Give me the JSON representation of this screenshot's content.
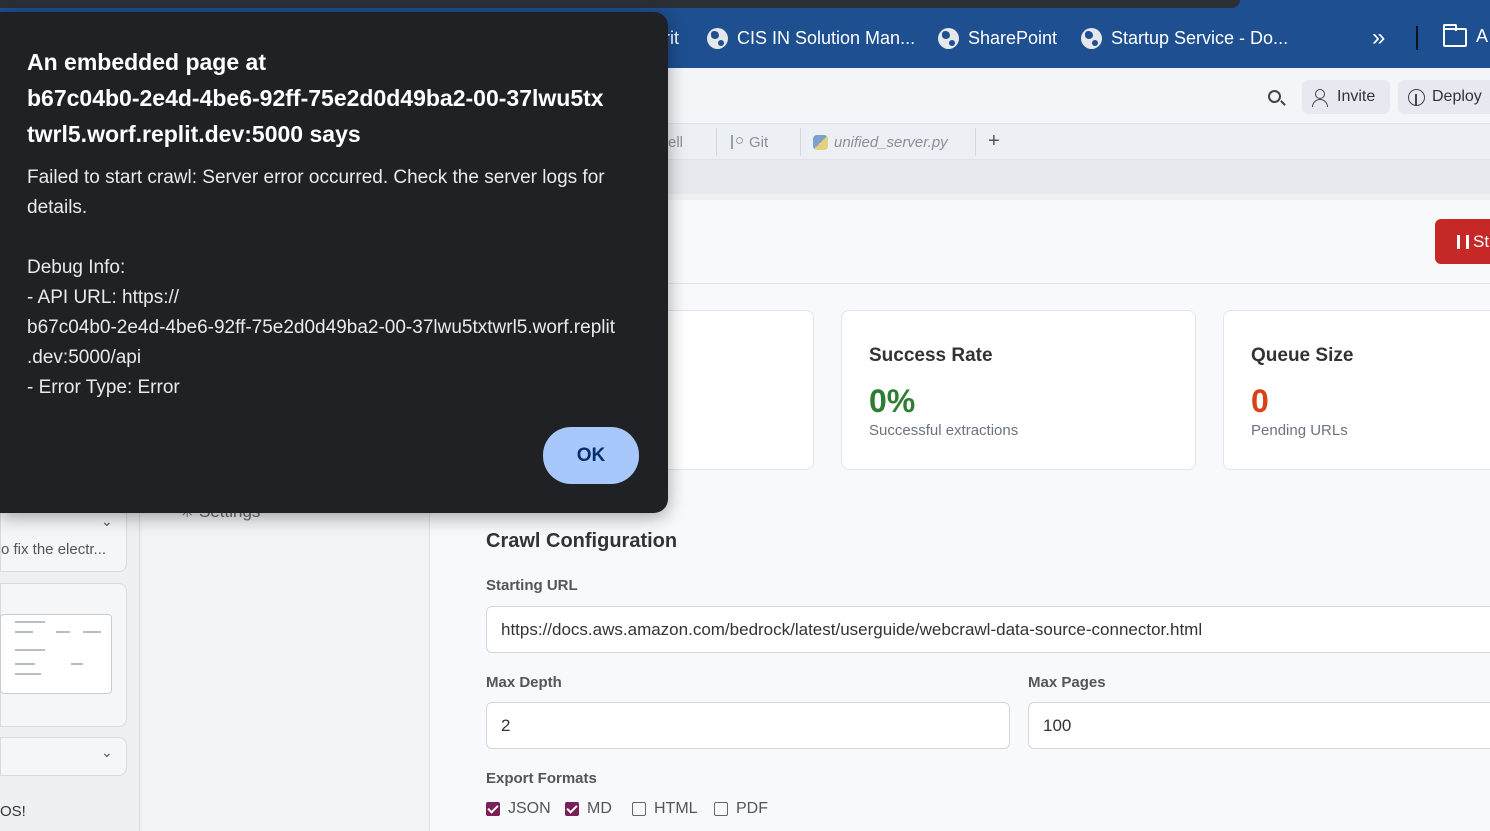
{
  "bookmarks": {
    "partial_label": "rit",
    "items": [
      {
        "label": "CIS IN Solution Man..."
      },
      {
        "label": "SharePoint"
      },
      {
        "label": "Startup Service - Do..."
      }
    ],
    "more_icon": "double-chevron-right-icon",
    "folder_label": "A"
  },
  "header": {
    "search_icon": "search-icon",
    "invite_label": "Invite",
    "deploy_label": "Deploy"
  },
  "tabs": {
    "shell_partial": "ell",
    "git_label": "Git",
    "file_label": "unified_server.py",
    "add_label": "+"
  },
  "left_panel": {
    "snippet_text": "o fix the electr...",
    "bottom_text": "OS!",
    "settings_label": "Settings"
  },
  "main": {
    "stop_label": "St",
    "stats": [
      {
        "title": "Success Rate",
        "value": "0%",
        "sub": "Successful extractions",
        "color": "#2e7d32"
      },
      {
        "title": "Queue Size",
        "value": "0",
        "sub": "Pending URLs",
        "color": "#d84315"
      }
    ],
    "config": {
      "title": "Crawl Configuration",
      "starting_url_label": "Starting URL",
      "starting_url_value": "https://docs.aws.amazon.com/bedrock/latest/userguide/webcrawl-data-source-connector.html",
      "max_depth_label": "Max Depth",
      "max_depth_value": "2",
      "max_pages_label": "Max Pages",
      "max_pages_value": "100",
      "export_formats_label": "Export Formats",
      "formats": [
        {
          "label": "JSON",
          "checked": true
        },
        {
          "label": "MD",
          "checked": true
        },
        {
          "label": "HTML",
          "checked": false
        },
        {
          "label": "PDF",
          "checked": false
        }
      ]
    }
  },
  "dialog": {
    "title_line1": "An embedded page at",
    "title_line2": "b67c04b0-2e4d-4be6-92ff-75e2d0d49ba2-00-37lwu5tx",
    "title_line3": "twrl5.worf.replit.dev:5000 says",
    "message_line1": "Failed to start crawl: Server error occurred. Check the server logs for",
    "message_line2": "details.",
    "debug_header": "Debug Info:",
    "debug_line1": "- API URL: https://",
    "debug_line2": "b67c04b0-2e4d-4be6-92ff-75e2d0d49ba2-00-37lwu5txtwrl5.worf.replit",
    "debug_line3": ".dev:5000/api",
    "debug_line4": "- Error Type: Error",
    "ok_label": "OK"
  }
}
